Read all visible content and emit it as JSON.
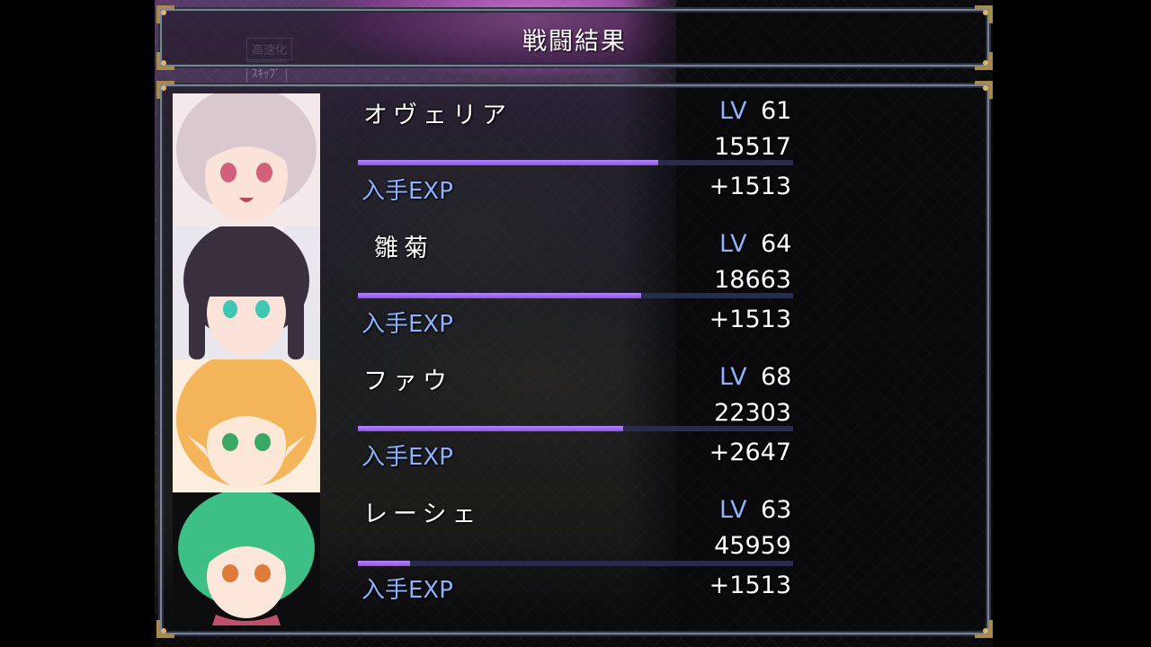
{
  "title": "戦闘結果",
  "background_ghost": [
    "高速化",
    "ｽｷｯﾌﾟ"
  ],
  "lv_label": "LV",
  "exp_label": "入手EXP",
  "members": [
    {
      "name": "オヴェリア",
      "level": "61",
      "exp": "15517",
      "gained": "+1513",
      "exp_progress": 0.69,
      "hair": "#d9c9cf",
      "eyes": "#d2607a"
    },
    {
      "name": "雛菊",
      "level": "64",
      "exp": "18663",
      "gained": "+1513",
      "exp_progress": 0.65,
      "hair": "#3a2f3c",
      "eyes": "#3fc7b3"
    },
    {
      "name": "ファウ",
      "level": "68",
      "exp": "22303",
      "gained": "+2647",
      "exp_progress": 0.61,
      "hair": "#f3b45a",
      "eyes": "#3aa864"
    },
    {
      "name": "レーシェ",
      "level": "63",
      "exp": "45959",
      "gained": "+1513",
      "exp_progress": 0.12,
      "hair": "#3ebf86",
      "eyes": "#e07a3a"
    }
  ],
  "colors": {
    "accent_blue": "#8fb2ff",
    "bar_fill": "#9b66f2",
    "bar_track": "#272b4e",
    "text": "#ffffff"
  }
}
